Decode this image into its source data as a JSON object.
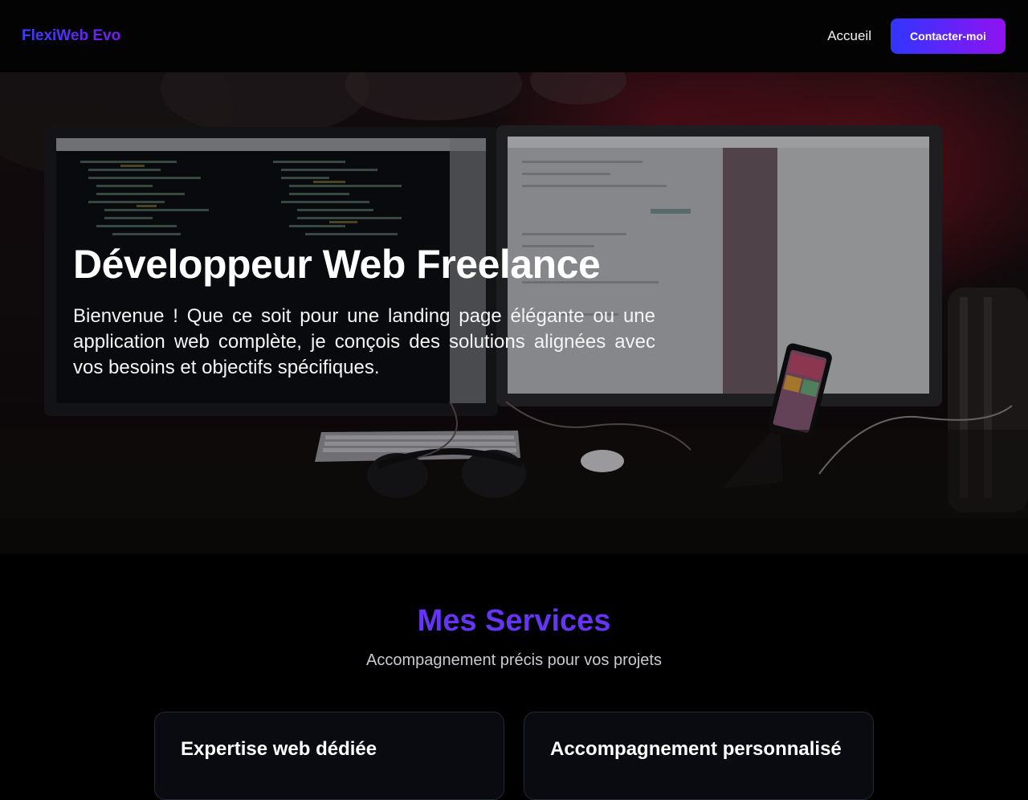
{
  "navbar": {
    "brand": "FlexiWeb Evo",
    "links": [
      {
        "label": "Accueil"
      }
    ],
    "cta_label": "Contacter-moi"
  },
  "hero": {
    "title": "Développeur Web Freelance",
    "text": "Bienvenue ! Que ce soit pour une landing page élégante ou une application web complète, je conçois des solutions alignées avec vos besoins et objectifs spécifiques."
  },
  "services": {
    "title": "Mes Services",
    "subtitle": "Accompagnement précis pour vos projets",
    "cards": [
      {
        "title": "Expertise web dédiée"
      },
      {
        "title": "Accompagnement personnalisé"
      }
    ]
  },
  "colors": {
    "accent_blue": "#3136ff",
    "accent_purple": "#9012f0",
    "section_title": "#6534f5",
    "background": "#000000",
    "card_background": "#090b10"
  }
}
